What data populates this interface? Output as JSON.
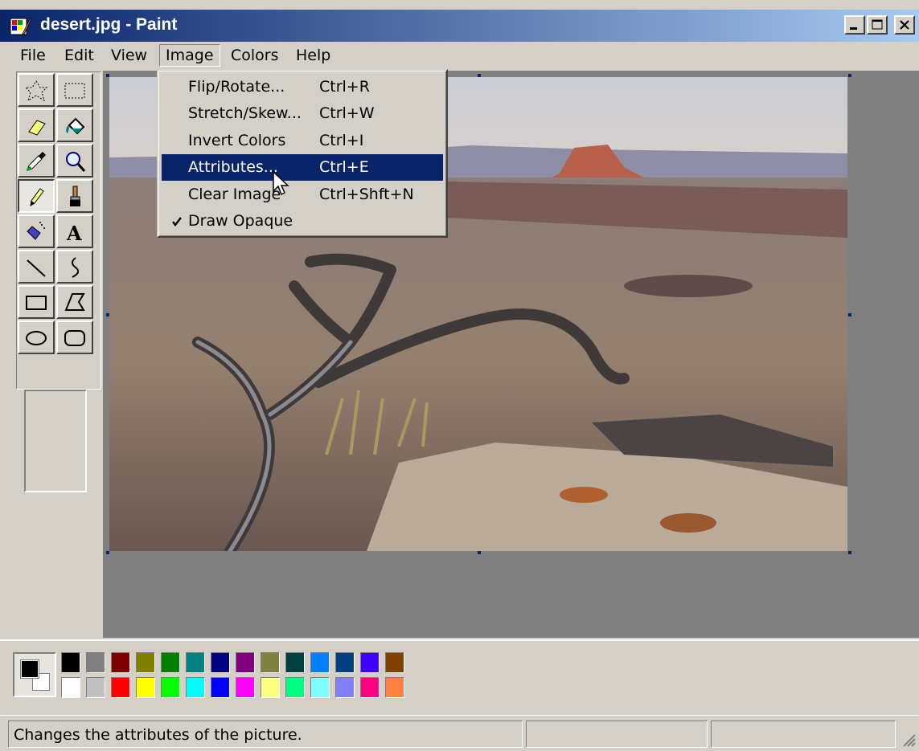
{
  "window": {
    "title": "desert.jpg - Paint",
    "icon": "paint-app-icon"
  },
  "window_controls": [
    "minimize-icon",
    "maximize-icon",
    "close-icon"
  ],
  "menubar": {
    "items": [
      {
        "label": "File"
      },
      {
        "label": "Edit"
      },
      {
        "label": "View"
      },
      {
        "label": "Image"
      },
      {
        "label": "Colors"
      },
      {
        "label": "Help"
      }
    ],
    "open_menu": "Image"
  },
  "image_menu": {
    "items": [
      {
        "label": "Flip/Rotate...",
        "shortcut": "Ctrl+R"
      },
      {
        "label": "Stretch/Skew...",
        "shortcut": "Ctrl+W"
      },
      {
        "label": "Invert Colors",
        "shortcut": "Ctrl+I"
      },
      {
        "label": "Attributes...",
        "shortcut": "Ctrl+E",
        "highlighted": true
      },
      {
        "label": "Clear Image",
        "shortcut": "Ctrl+Shft+N"
      },
      {
        "label": "Draw Opaque",
        "shortcut": "",
        "checked": true
      }
    ]
  },
  "toolbox": {
    "tools": [
      "free-form-select-icon",
      "rectangle-select-icon",
      "eraser-icon",
      "fill-bucket-icon",
      "color-picker-icon",
      "magnifier-icon",
      "pencil-icon",
      "brush-icon",
      "airbrush-icon",
      "text-icon",
      "line-icon",
      "curve-icon",
      "rectangle-icon",
      "polygon-icon",
      "ellipse-icon",
      "rounded-rectangle-icon"
    ],
    "active_tool": "pencil-icon",
    "text_tool_glyph": "A"
  },
  "canvas": {
    "content": "desert landscape photo"
  },
  "colors": {
    "foreground": "#000000",
    "background": "#ffffff",
    "palette_top": [
      "#000000",
      "#808080",
      "#800000",
      "#808000",
      "#008000",
      "#008080",
      "#000080",
      "#800080",
      "#808040",
      "#004040",
      "#0080ff",
      "#004080",
      "#4000ff",
      "#804000"
    ],
    "palette_bottom": [
      "#ffffff",
      "#c0c0c0",
      "#ff0000",
      "#ffff00",
      "#00ff00",
      "#00ffff",
      "#0000ff",
      "#ff00ff",
      "#ffff80",
      "#00ff80",
      "#80ffff",
      "#8080ff",
      "#ff0080",
      "#ff8040"
    ]
  },
  "statusbar": {
    "message": "Changes the attributes of the picture.",
    "cell2": "",
    "cell3": ""
  }
}
